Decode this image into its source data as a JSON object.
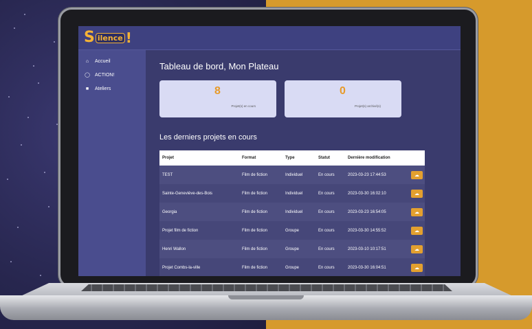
{
  "app": {
    "logo_initial": "S",
    "logo_text": "ilence",
    "logo_mark": "!"
  },
  "sidebar": {
    "items": [
      {
        "label": "Accueil",
        "icon": "home-icon",
        "glyph": "⌂"
      },
      {
        "label": "ACTION!",
        "icon": "chat-icon",
        "glyph": "◯"
      },
      {
        "label": "Ateliers",
        "icon": "book-icon",
        "glyph": "■"
      }
    ]
  },
  "main": {
    "title": "Tableau de bord, Mon Plateau",
    "stats": [
      {
        "value": "8",
        "label": "Projet(s) en cours"
      },
      {
        "value": "0",
        "label": "Projet(s) archivé(s)"
      }
    ],
    "section_title": "Les derniers projets en cours",
    "table": {
      "headers": [
        "Projet",
        "Format",
        "Type",
        "Statut",
        "Dernière modification"
      ],
      "rows": [
        [
          "TEST",
          "Film de fiction",
          "Individuel",
          "En cours",
          "2023-03-23 17:44:53"
        ],
        [
          "Sainte-Geneviève-des-Bois",
          "Film de fiction",
          "Individuel",
          "En cours",
          "2023-03-30 16:02:10"
        ],
        [
          "Georgia",
          "Film de fiction",
          "Individuel",
          "En cours",
          "2023-03-23 16:54:05"
        ],
        [
          "Projet film de fiction",
          "Film de fiction",
          "Groupe",
          "En cours",
          "2023-03-30 14:55:52"
        ],
        [
          "Henri Wallon",
          "Film de fiction",
          "Groupe",
          "En cours",
          "2023-03-10 10:17:51"
        ],
        [
          "Projet Combs-la-ville",
          "Film de fiction",
          "Groupe",
          "En cours",
          "2023-03-30 16:04:51"
        ]
      ],
      "row_action_icon": "cloud-download-icon"
    }
  },
  "colors": {
    "accent": "#e3a02f",
    "topbar": "#3e4180",
    "sidebar": "#4a4d8e",
    "main_bg": "#3a3b6d",
    "card_bg": "#d9dbf4",
    "background_right": "#d69a2c"
  }
}
